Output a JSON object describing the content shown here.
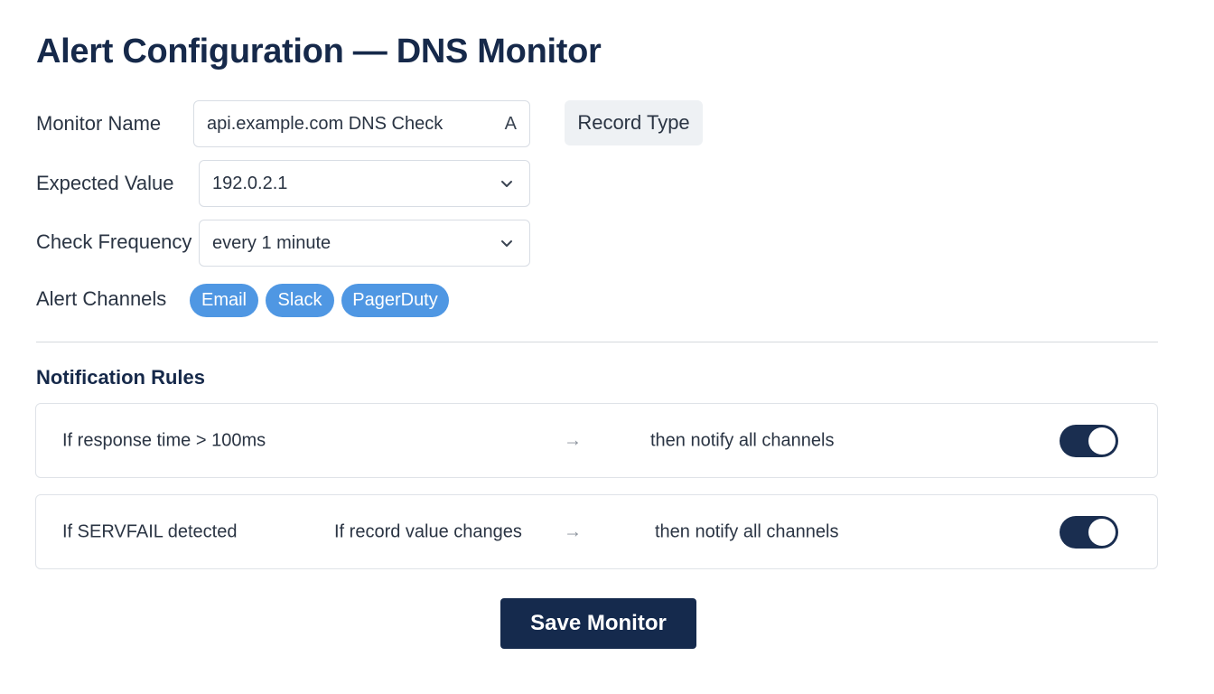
{
  "page_title": "Alert Configuration — DNS Monitor",
  "form": {
    "monitor_name": {
      "label": "Monitor Name",
      "value": "api.example.com DNS Check",
      "suffix": "A"
    },
    "record_type": {
      "label": "Record Type"
    },
    "expected_value": {
      "label": "Expected Value",
      "value": "192.0.2.1"
    },
    "check_frequency": {
      "label": "Check Frequency",
      "value": "every 1 minute"
    },
    "alert_channels": {
      "label": "Alert Channels",
      "chips": [
        "Email",
        "Slack",
        "PagerDuty"
      ]
    }
  },
  "notification_rules": {
    "title": "Notification Rules",
    "rules": [
      {
        "condition": "If response time > 100ms",
        "arrow": "→",
        "action": "then notify all channels",
        "enabled": true
      },
      {
        "condition": "If SERVFAIL detected",
        "condition_2": "If record value changes",
        "arrow": "→",
        "action": "then notify all channels",
        "enabled": true
      }
    ]
  },
  "actions": {
    "save_label": "Save Monitor"
  },
  "icons": {
    "dropdown": "chevron-down-icon",
    "arrow": "arrow-right-icon"
  },
  "colors": {
    "title": "#16294a",
    "chip": "#4f97e3",
    "toggle_on": "#1a2e50",
    "primary_button": "#152a4d"
  }
}
